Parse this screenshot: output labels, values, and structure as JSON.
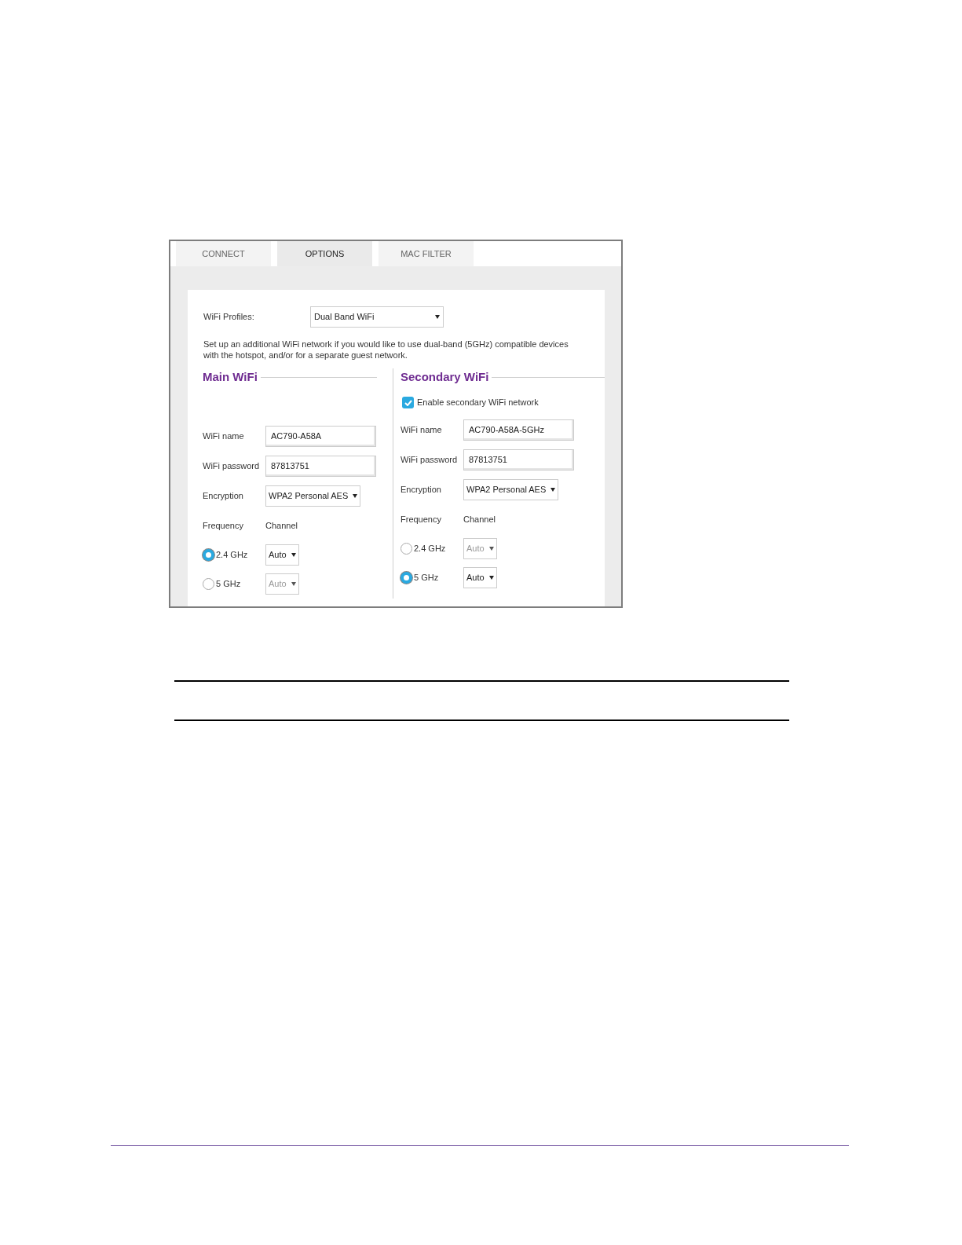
{
  "tabs": [
    {
      "label": "CONNECT",
      "selected": false
    },
    {
      "label": "OPTIONS",
      "selected": true
    },
    {
      "label": "MAC FILTER",
      "selected": false
    }
  ],
  "profile": {
    "label": "WiFi Profiles:",
    "value": "Dual Band WiFi"
  },
  "description": "Set up an additional WiFi network if you would like to use dual-band (5GHz) compatible devices with the hotspot, and/or for a separate guest network.",
  "networks": [
    {
      "title": "Main WiFi",
      "name_label": "WiFi name",
      "name": "AC790-A58A",
      "password_label": "WiFi password",
      "password": "87813751",
      "encryption_label": "Encryption",
      "encryption": "WPA2 Personal AES",
      "frequency_header": "Frequency",
      "channel_header": "Channel",
      "frequencies": [
        {
          "label": "2.4 GHz",
          "selected": true,
          "channel": "Auto"
        },
        {
          "label": "5 GHz",
          "selected": false,
          "channel": "Auto"
        }
      ]
    },
    {
      "title": "Secondary WiFi",
      "enable": {
        "label": "Enable secondary WiFi network",
        "checked": true
      },
      "name_label": "WiFi name",
      "name": "AC790-A58A-5GHz",
      "password_label": "WiFi password",
      "password": "87813751",
      "encryption_label": "Encryption",
      "encryption": "WPA2 Personal AES",
      "frequency_header": "Frequency",
      "channel_header": "Channel",
      "frequencies": [
        {
          "label": "2.4 GHz",
          "selected": false,
          "channel": "Auto"
        },
        {
          "label": "5 GHz",
          "selected": true,
          "channel": "Auto"
        }
      ]
    }
  ]
}
